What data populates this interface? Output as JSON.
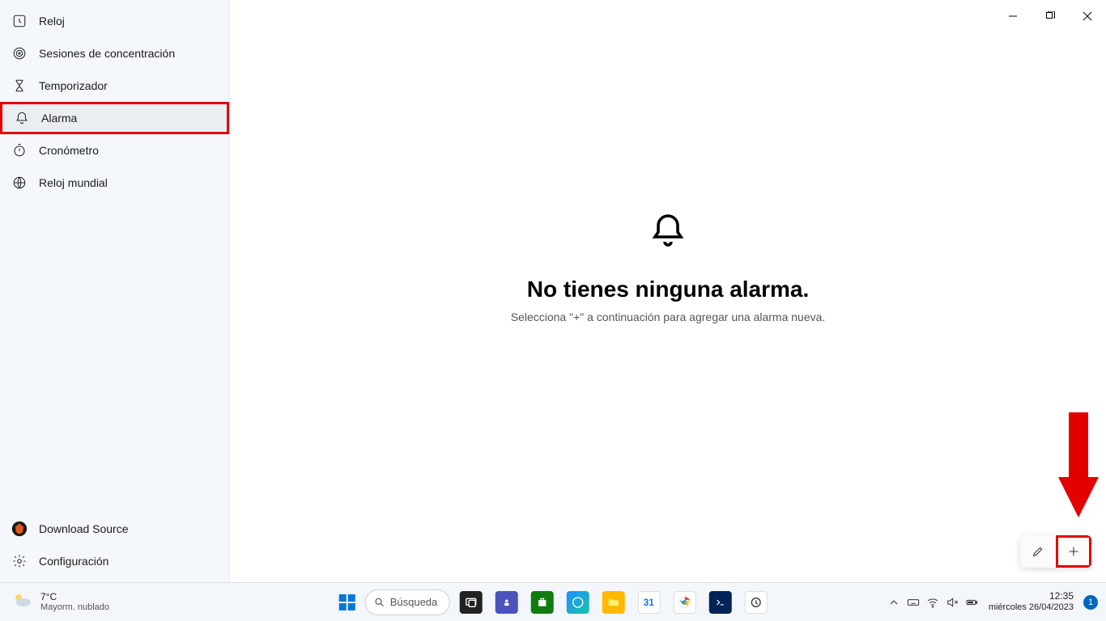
{
  "app_title": "Reloj",
  "sidebar": {
    "items": [
      {
        "id": "focus",
        "label": "Sesiones de concentración",
        "icon": "target"
      },
      {
        "id": "timer",
        "label": "Temporizador",
        "icon": "hourglass"
      },
      {
        "id": "alarm",
        "label": "Alarma",
        "icon": "bell",
        "selected": true,
        "highlighted": true
      },
      {
        "id": "stopwatch",
        "label": "Cronómetro",
        "icon": "stopwatch"
      },
      {
        "id": "world",
        "label": "Reloj mundial",
        "icon": "globe"
      }
    ],
    "footer": {
      "download_source": "Download Source",
      "settings": "Configuración"
    }
  },
  "main": {
    "empty_heading": "No tienes ninguna alarma.",
    "empty_sub": "Selecciona \"+\" a continuación para agregar una alarma nueva."
  },
  "fab": {
    "edit": "edit",
    "add": "add"
  },
  "taskbar": {
    "search_label": "Búsqueda",
    "weather_temp": "7°C",
    "weather_desc": "Mayorm. nublado",
    "clock_time": "12:35",
    "clock_date": "miércoles 26/04/2023",
    "notif_count": "1"
  }
}
